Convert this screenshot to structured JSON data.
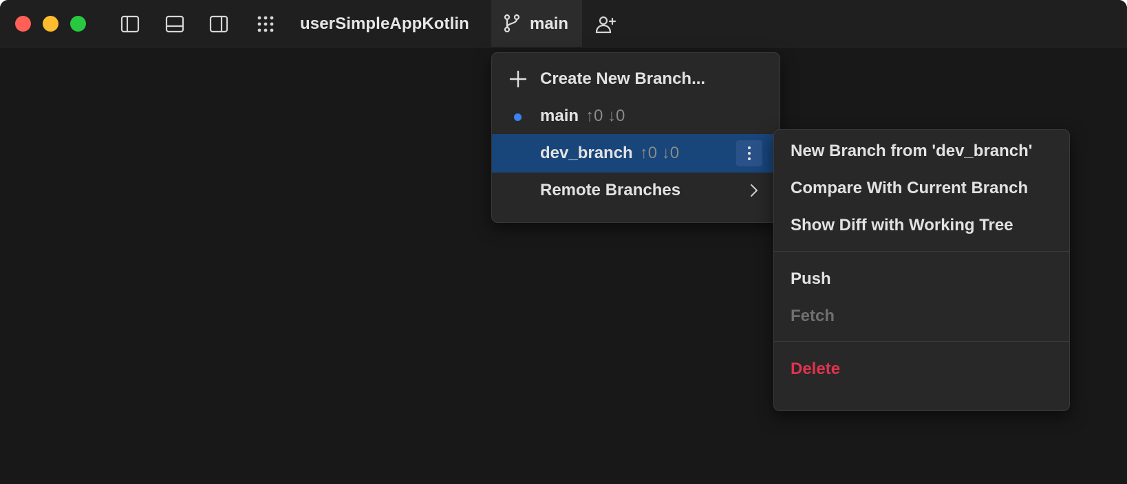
{
  "window": {
    "controls": [
      "close",
      "minimize",
      "zoom"
    ],
    "toolbar_icons": [
      "sidebar-left-icon",
      "panel-bottom-icon",
      "sidebar-right-icon",
      "grid-dots-icon"
    ],
    "project_name": "userSimpleAppKotlin"
  },
  "branch_button": {
    "icon": "git-branch-icon",
    "label": "main"
  },
  "add_user_icon": "person-add-icon",
  "branch_menu": {
    "create_label": "Create New Branch...",
    "items": [
      {
        "name": "main",
        "counts": "↑0 ↓0",
        "current": true
      },
      {
        "name": "dev_branch",
        "counts": "↑0 ↓0",
        "selected": true
      }
    ],
    "remote_label": "Remote Branches"
  },
  "context_menu": {
    "items": [
      {
        "label": "New Branch from 'dev_branch'"
      },
      {
        "label": "Compare With Current Branch"
      },
      {
        "label": "Show Diff with Working Tree"
      },
      {
        "label": "Push"
      },
      {
        "label": "Fetch",
        "disabled": true
      },
      {
        "label": "Delete",
        "danger": true
      }
    ]
  },
  "colors": {
    "selection": "#18457a",
    "current_dot": "#3b82f6",
    "danger": "#e0334d"
  }
}
